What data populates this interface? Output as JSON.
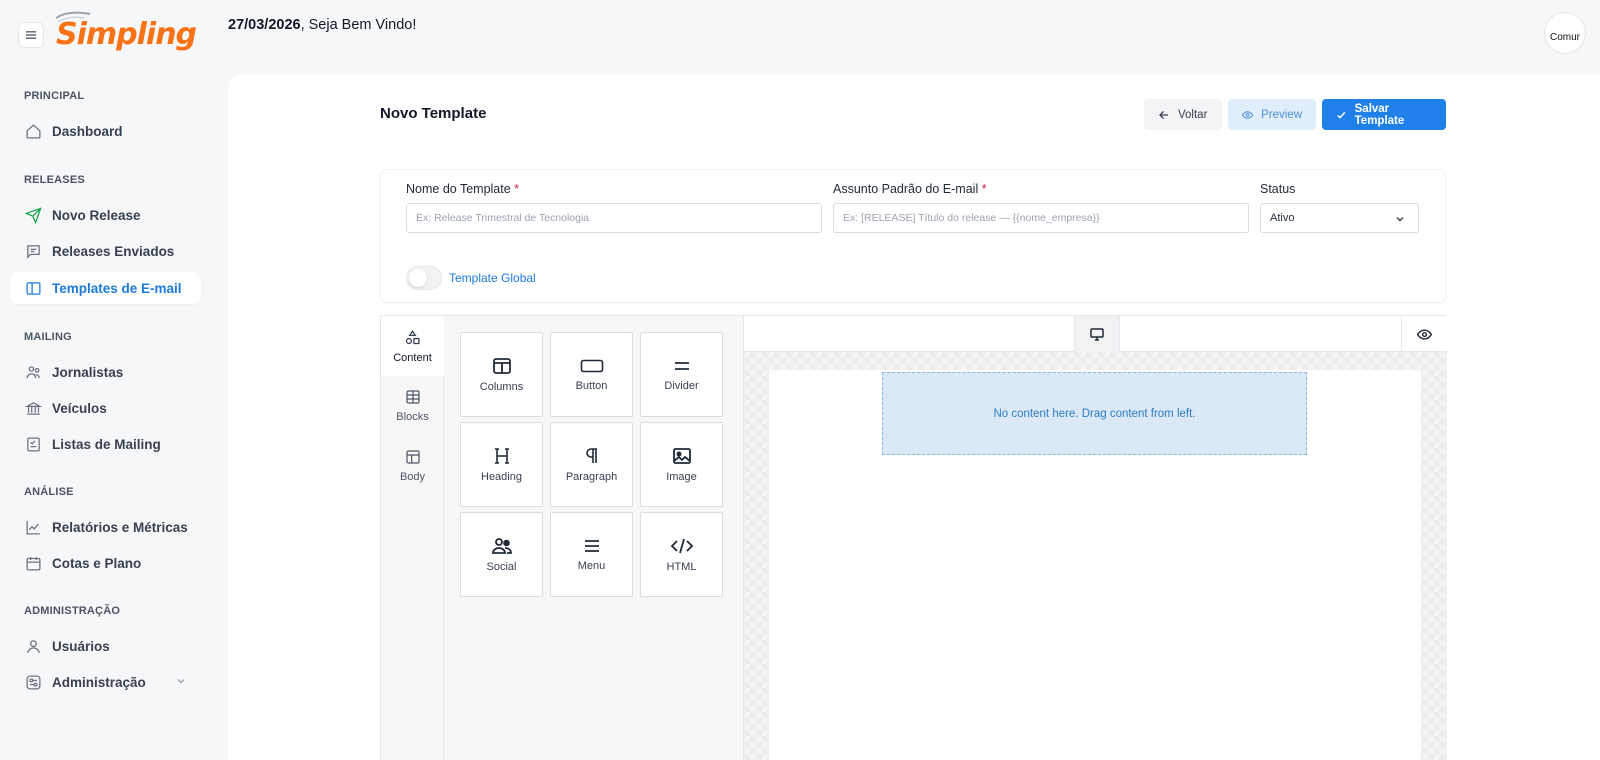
{
  "brand": {
    "logo_text": "Simpling",
    "accent": "#1f80ea",
    "logo_color": "#f97316"
  },
  "header": {
    "date": "27/03/2026",
    "welcome": ", Seja Bem Vindo!",
    "avatar_alt": "Comur"
  },
  "sidebar": {
    "sections": [
      {
        "title": "PRINCIPAL"
      },
      {
        "title": "RELEASES"
      },
      {
        "title": "MAILING"
      },
      {
        "title": "ANÁLISE"
      },
      {
        "title": "ADMINISTRAÇÃO"
      }
    ],
    "items": [
      {
        "label": "Dashboard",
        "icon": "home-icon"
      },
      {
        "label": "Novo Release",
        "icon": "send-icon"
      },
      {
        "label": "Releases Enviados",
        "icon": "message-icon"
      },
      {
        "label": "Templates de E-mail",
        "icon": "layout-icon",
        "active": true
      },
      {
        "label": "Jornalistas",
        "icon": "users-icon"
      },
      {
        "label": "Veículos",
        "icon": "bank-icon"
      },
      {
        "label": "Listas de Mailing",
        "icon": "list-icon"
      },
      {
        "label": "Relatórios e Métricas",
        "icon": "chart-icon"
      },
      {
        "label": "Cotas e Plano",
        "icon": "calendar-icon"
      },
      {
        "label": "Usuários",
        "icon": "user-icon"
      },
      {
        "label": "Administração",
        "icon": "settings-icon"
      }
    ]
  },
  "page": {
    "title": "Novo Template",
    "back_label": "Voltar",
    "preview_label": "Preview",
    "save_label": "Salvar Template"
  },
  "form": {
    "name_label": "Nome do Template",
    "name_placeholder": "Ex: Release Trimestral de Tecnologia",
    "subject_label": "Assunto Padrão do E-mail",
    "subject_placeholder": "Ex: [RELEASE] Título do release — {{nome_empresa}}",
    "status_label": "Status",
    "status_value": "Ativo",
    "required_mark": "*",
    "global_label": "Template Global",
    "global_enabled": false
  },
  "editor": {
    "tabs": [
      {
        "label": "Content",
        "icon": "shapes-icon"
      },
      {
        "label": "Blocks",
        "icon": "blocks-icon"
      },
      {
        "label": "Body",
        "icon": "body-icon"
      }
    ],
    "tools": [
      {
        "label": "Columns",
        "icon": "columns-icon"
      },
      {
        "label": "Button",
        "icon": "button-icon"
      },
      {
        "label": "Divider",
        "icon": "divider-icon"
      },
      {
        "label": "Heading",
        "icon": "heading-icon"
      },
      {
        "label": "Paragraph",
        "icon": "paragraph-icon"
      },
      {
        "label": "Image",
        "icon": "image-icon"
      },
      {
        "label": "Social",
        "icon": "social-icon"
      },
      {
        "label": "Menu",
        "icon": "menu-icon"
      },
      {
        "label": "HTML",
        "icon": "code-icon"
      }
    ],
    "empty_message": "No content here. Drag content from left."
  }
}
